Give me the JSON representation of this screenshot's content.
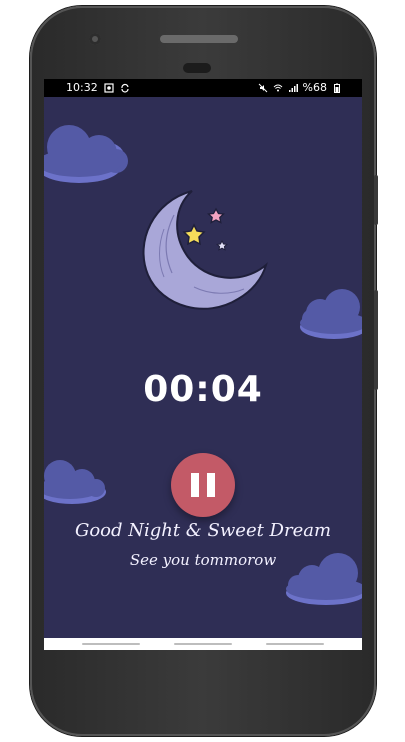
{
  "statusbar": {
    "time": "10:32",
    "battery": "%68",
    "icons": [
      "photo-icon",
      "sync-icon",
      "mute-icon",
      "wifi-icon",
      "signal-icon",
      "battery-icon"
    ]
  },
  "player": {
    "timer": "00:04",
    "pause_icon": "pause-icon"
  },
  "message": {
    "line1": "Good Night & Sweet Dream",
    "line2": "See you tommorow"
  },
  "colors": {
    "background": "#2f2e55",
    "moon": "#a9a7d8",
    "cloud": "#545aa6",
    "pause_button": "#c35a67",
    "star_yellow": "#f5dd5a",
    "star_pink": "#f4a3c1"
  }
}
